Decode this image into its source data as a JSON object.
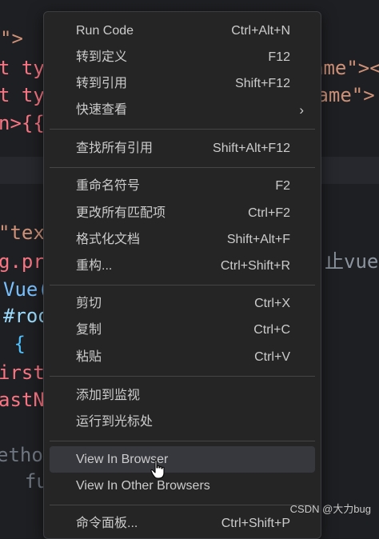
{
  "editor": {
    "lines": [
      {
        "text": "\">",
        "color": "#ce9178"
      },
      {
        "text": "t ty",
        "color": "#f97583"
      },
      {
        "text": "t ty",
        "color": "#f97583"
      },
      {
        "text": "n>{{",
        "color": "#f97583"
      },
      {
        "text": "\"tex",
        "color": "#ce9178"
      },
      {
        "text": "g.pr",
        "color": "#f97583"
      },
      {
        "text": "Vue(",
        "color": "#79c0ff"
      },
      {
        "text": "#roo",
        "color": "#9cdcfe"
      },
      {
        "text": " {",
        "color": "#4fc1ff"
      },
      {
        "text": "irst",
        "color": "#f97583"
      },
      {
        "text": "astN",
        "color": "#f97583"
      },
      {
        "text": "ethod",
        "color": "#6e7681"
      },
      {
        "text": "  fu",
        "color": "#6e7681"
      }
    ],
    "right_fragments": [
      {
        "text": "ame\"><",
        "color": "#ce9178"
      },
      {
        "text": "Name\">",
        "color": "#ce9178"
      },
      {
        "text": "止vue",
        "color": "#8b949e"
      }
    ]
  },
  "context_menu": {
    "items": [
      {
        "label": "Run Code",
        "shortcut": "Ctrl+Alt+N"
      },
      {
        "label": "转到定义",
        "shortcut": "F12"
      },
      {
        "label": "转到引用",
        "shortcut": "Shift+F12"
      },
      {
        "label": "快速查看",
        "shortcut": ""
      },
      {
        "label": "查找所有引用",
        "shortcut": "Shift+Alt+F12"
      },
      {
        "label": "重命名符号",
        "shortcut": "F2"
      },
      {
        "label": "更改所有匹配项",
        "shortcut": "Ctrl+F2"
      },
      {
        "label": "格式化文档",
        "shortcut": "Shift+Alt+F"
      },
      {
        "label": "重构...",
        "shortcut": "Ctrl+Shift+R"
      },
      {
        "label": "剪切",
        "shortcut": "Ctrl+X"
      },
      {
        "label": "复制",
        "shortcut": "Ctrl+C"
      },
      {
        "label": "粘贴",
        "shortcut": "Ctrl+V"
      },
      {
        "label": "添加到监视",
        "shortcut": ""
      },
      {
        "label": "运行到光标处",
        "shortcut": ""
      },
      {
        "label": "View In Browser",
        "shortcut": ""
      },
      {
        "label": "View In Other Browsers",
        "shortcut": ""
      },
      {
        "label": "命令面板...",
        "shortcut": "Ctrl+Shift+P"
      }
    ],
    "submenu_icon": "chevron-right-icon",
    "hovered_item": "View In Browser"
  },
  "watermark": "CSDN @大力bug",
  "colors": {
    "menu_bg": "#252526",
    "menu_text": "#cccccc",
    "hover_bg": "#37383d",
    "editor_bg": "#1e1f22"
  }
}
